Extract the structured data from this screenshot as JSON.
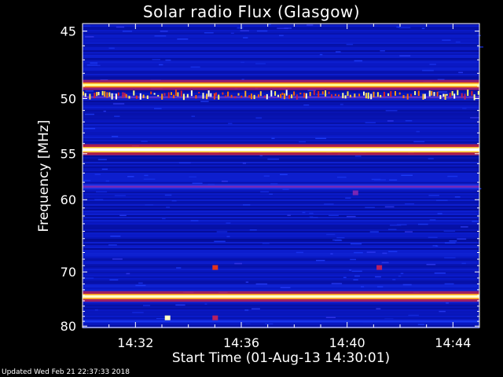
{
  "chart_data": {
    "type": "heatmap",
    "title": "Solar radio Flux (Glasgow)",
    "xlabel": "Start Time (01-Aug-13 14:30:01)",
    "ylabel": "Frequency [MHz]",
    "x_ticks": [
      "14:32",
      "14:36",
      "14:40",
      "14:44"
    ],
    "x_tick_minutes": [
      2,
      6,
      10,
      14
    ],
    "x_range_minutes": [
      0,
      15
    ],
    "y_ticks": [
      45,
      50,
      55,
      60,
      70,
      80
    ],
    "y_range_mhz": [
      44.5,
      80.3
    ],
    "y_scale": "reciprocal",
    "colormap": [
      "#000066",
      "#0a1ac8",
      "#2040ff",
      "#9020a0",
      "#e02020",
      "#ff8000",
      "#ffff60",
      "#ffffff"
    ],
    "background_level": 0.12,
    "bright_bands": [
      {
        "freq_mhz": 48.9,
        "intensity": 0.9
      },
      {
        "freq_mhz": 49.9,
        "intensity": 0.5,
        "bursty": true
      },
      {
        "freq_mhz": 54.6,
        "intensity": 1.0
      },
      {
        "freq_mhz": 58.5,
        "intensity": 0.4
      },
      {
        "freq_mhz": 74.2,
        "intensity": 0.95
      },
      {
        "freq_mhz": 79.0,
        "intensity": 0.25
      }
    ],
    "spots": [
      {
        "minute": 3.2,
        "freq_mhz": 78.3,
        "intensity": 0.95
      },
      {
        "minute": 5.0,
        "freq_mhz": 69.3,
        "intensity": 0.6
      },
      {
        "minute": 11.2,
        "freq_mhz": 69.3,
        "intensity": 0.5
      },
      {
        "minute": 10.3,
        "freq_mhz": 59.2,
        "intensity": 0.4
      },
      {
        "minute": 5.0,
        "freq_mhz": 78.3,
        "intensity": 0.5
      }
    ]
  },
  "footer": "Updated Wed Feb 21 22:37:33 2018"
}
